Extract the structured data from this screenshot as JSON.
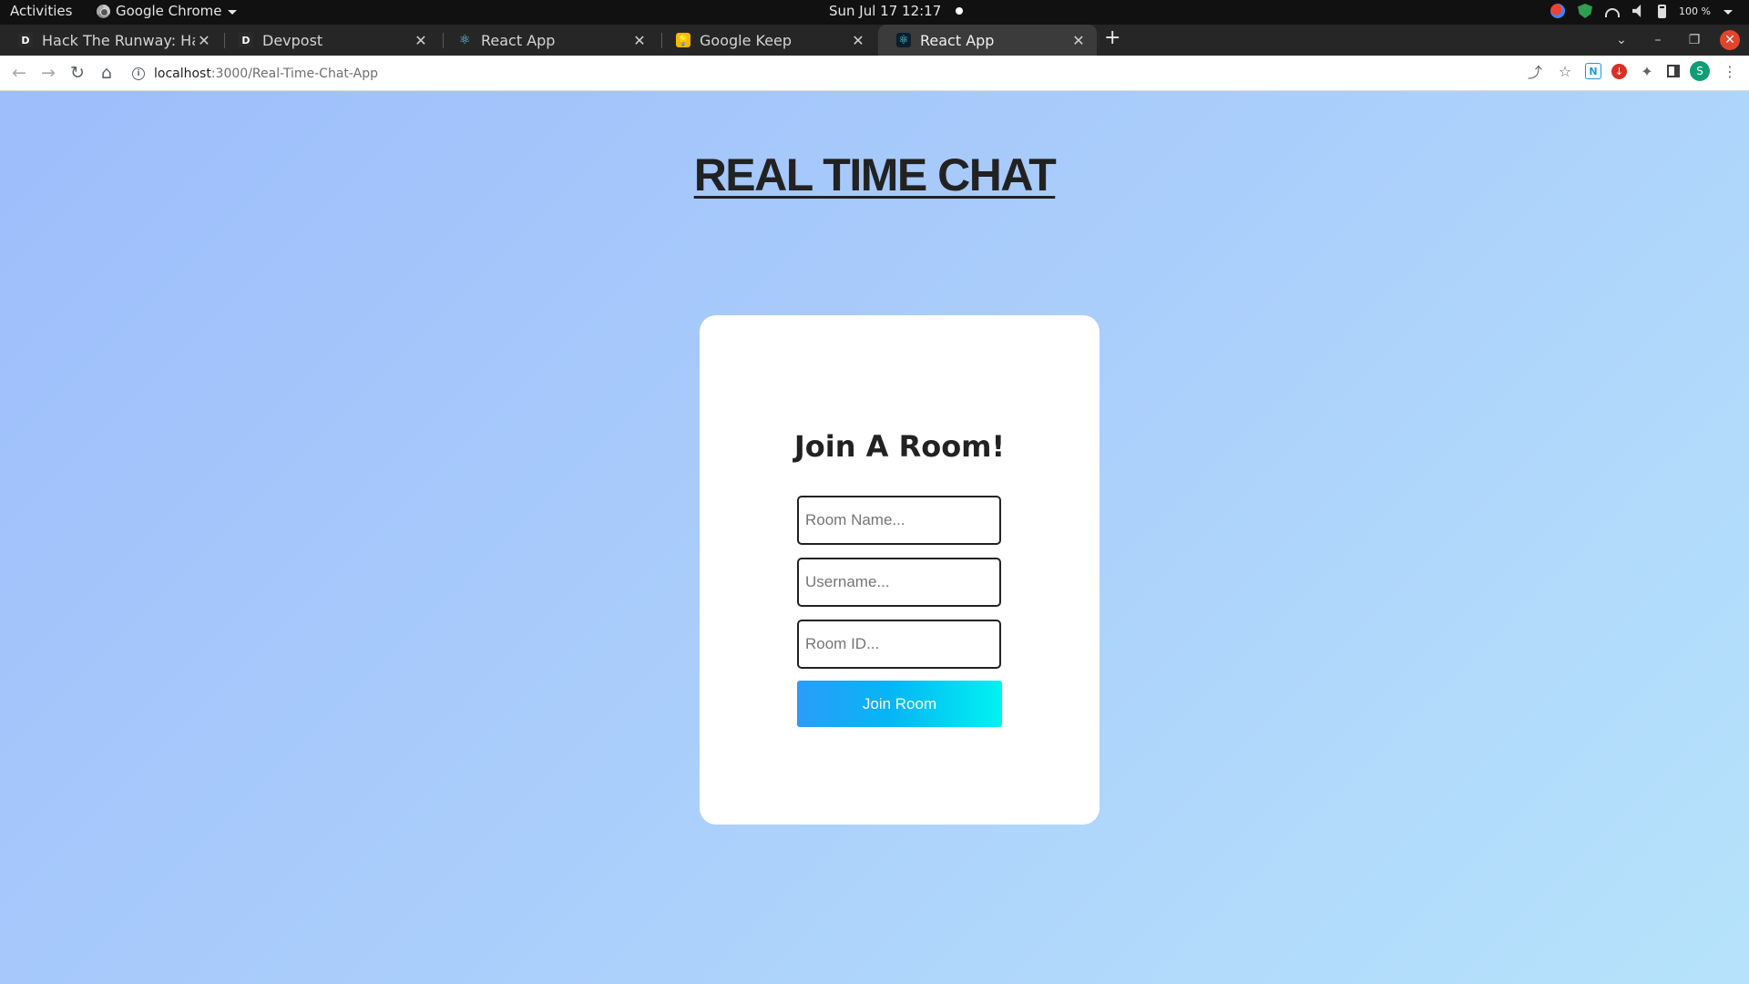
{
  "system_bar": {
    "activities": "Activities",
    "app_name": "Google Chrome",
    "datetime": "Sun Jul 17  12:17",
    "battery": "100 %"
  },
  "tabs": [
    {
      "title": "Hack The Runway: Hack",
      "favicon": "D"
    },
    {
      "title": "Devpost",
      "favicon": "D"
    },
    {
      "title": "React App",
      "favicon": "⚛"
    },
    {
      "title": "Google Keep",
      "favicon": "💡"
    },
    {
      "title": "React App",
      "favicon": "⚛",
      "active": true
    }
  ],
  "address_bar": {
    "host": "localhost",
    "path": ":3000/Real-Time-Chat-App"
  },
  "profile": {
    "initial": "S"
  },
  "page": {
    "title": "REAL TIME CHAT",
    "card_title": "Join A Room!",
    "room_name_placeholder": "Room Name...",
    "username_placeholder": "Username...",
    "room_id_placeholder": "Room ID...",
    "join_label": "Join Room"
  },
  "colors": {
    "background_start": "#9dbdfb",
    "background_end": "#b6e3fb",
    "button_start": "#2a9df8",
    "button_end": "#00f2f2"
  }
}
